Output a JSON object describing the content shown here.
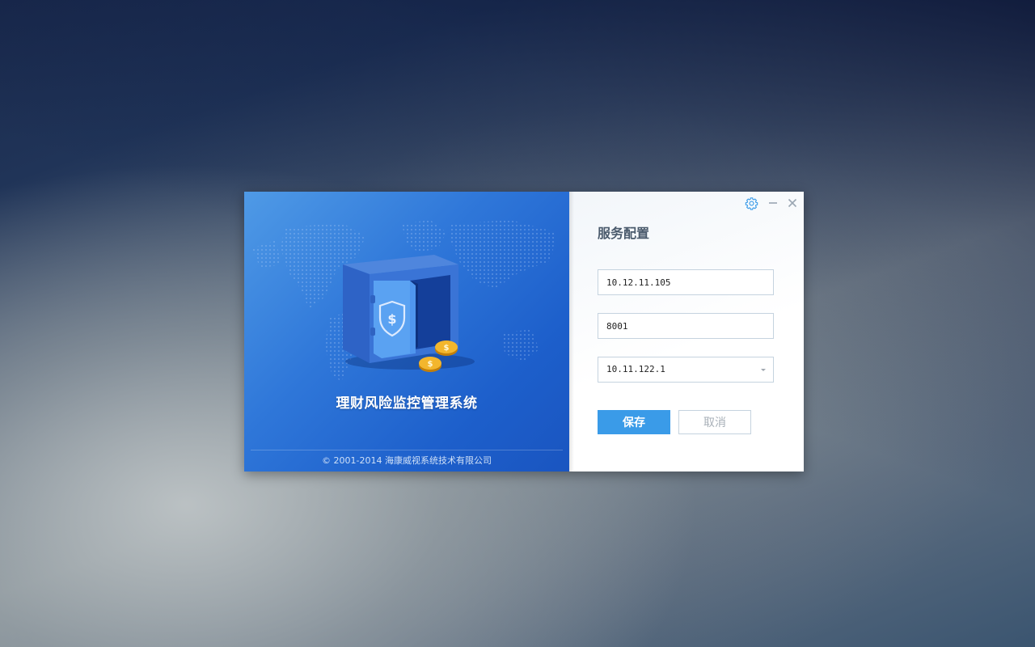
{
  "brand": {
    "app_title": "理财风险监控管理系统",
    "copyright": "© 2001-2014 海康威视系统技术有限公司"
  },
  "window_controls": {
    "settings_icon": "gear-icon",
    "minimize_icon": "minimize-icon",
    "close_icon": "close-icon"
  },
  "form": {
    "title": "服务配置",
    "server_ip": "10.12.11.105",
    "port": "8001",
    "selected_address": "10.11.122.1",
    "save_label": "保存",
    "cancel_label": "取消"
  },
  "colors": {
    "brand_blue": "#2f77d9",
    "save_button": "#3a9be8",
    "icon_accent": "#3a9be8"
  }
}
